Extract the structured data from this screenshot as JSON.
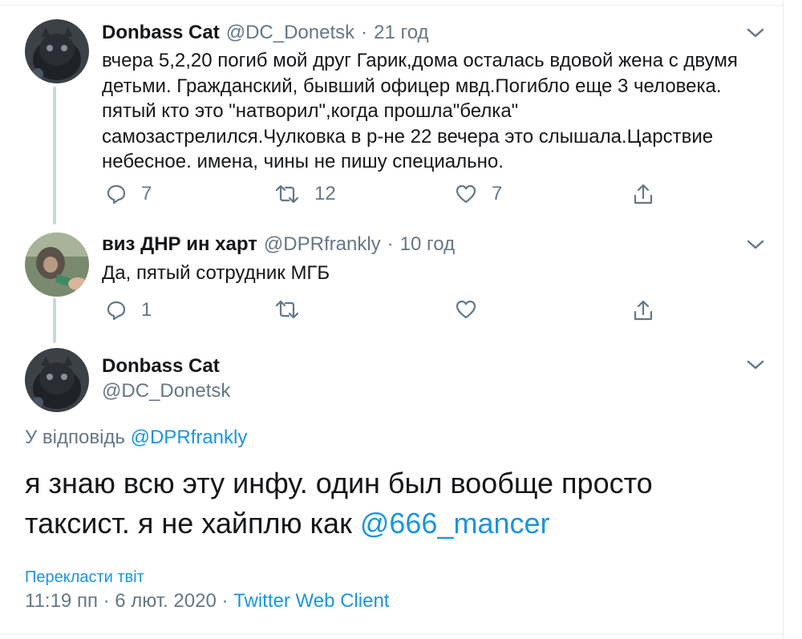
{
  "tweets": [
    {
      "name": "Donbass Cat",
      "handle": "@DC_Donetsk",
      "time": "21 год",
      "text": "вчера 5,2,20 погиб мой друг Гарик,дома осталась вдовой жена с двумя детьми. Гражданский, бывший офицер мвд.Погибло еще 3 человека. пятый кто это \"натворил\",когда прошла\"белка\" самозастрелился.Чулковка в р-не 22 вечера это слышала.Царствие небесное. имена, чины не пишу специально.",
      "replies": "7",
      "retweets": "12",
      "likes": "7"
    },
    {
      "name": "виз ДНР ин харт",
      "handle": "@DPRfrankly",
      "time": "10 год",
      "text": "Да, пятый сотрудник МГБ",
      "replies": "1",
      "retweets": "",
      "likes": ""
    }
  ],
  "main_tweet": {
    "name": "Donbass Cat",
    "handle": "@DC_Donetsk",
    "reply_prefix": "У відповідь",
    "reply_to": "@DPRfrankly",
    "text": "я знаю всю эту инфу. один был вообще просто таксист. я не хайплю как",
    "mention": "@666_mancer",
    "translate": "Перекласти твіт",
    "timestamp": "11:19 пп · 6 лют. 2020",
    "client": "Twitter Web Client"
  },
  "meta_separator": "·",
  "icons": [
    "reply-icon",
    "retweet-icon",
    "like-icon",
    "share-icon",
    "chevron-down-icon"
  ],
  "colors": {
    "link": "#1b95e0",
    "muted": "#657786",
    "line": "#ccd6dd"
  }
}
